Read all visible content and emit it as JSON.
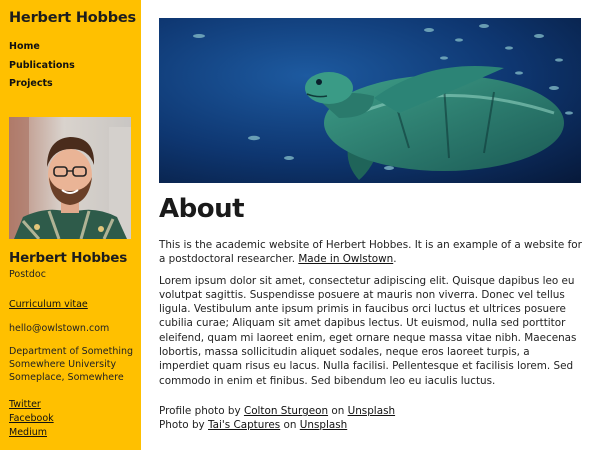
{
  "sidebar": {
    "site_title": "Herbert Hobbes",
    "nav": [
      {
        "label": "Home"
      },
      {
        "label": "Publications"
      },
      {
        "label": "Projects"
      }
    ],
    "person_name": "Herbert Hobbes",
    "person_role": "Postdoc",
    "cv_link": "Curriculum vitae",
    "email": "hello@owlstown.com",
    "address": [
      "Department of Something",
      "Somewhere University",
      "Someplace, Somewhere"
    ],
    "social": [
      {
        "label": "Twitter"
      },
      {
        "label": "Facebook"
      },
      {
        "label": "Medium"
      }
    ]
  },
  "main": {
    "hero_image": "sea-turtle-underwater-photo",
    "title": "About",
    "intro_text": "This is the academic website of Herbert Hobbes. It is an example of a website for a postdoctoral researcher. ",
    "intro_link": "Made in Owlstown",
    "intro_end": ".",
    "body_text": "Lorem ipsum dolor sit amet, consectetur adipiscing elit. Quisque dapibus leo eu volutpat sagittis. Suspendisse posuere at mauris non viverra. Donec vel tellus ligula. Vestibulum ante ipsum primis in faucibus orci luctus et ultrices posuere cubilia curae; Aliquam sit amet dapibus lectus. Ut euismod, nulla sed porttitor eleifend, quam mi laoreet enim, eget ornare neque massa vitae nibh. Maecenas lobortis, massa sollicitudin aliquet sodales, neque eros laoreet turpis, a imperdiet quam risus eu lacus. Nulla facilisi. Pellentesque et facilisis lorem. Sed commodo in enim et finibus. Sed bibendum leo eu iaculis luctus.",
    "credits": {
      "profile_prefix": "Profile photo by ",
      "profile_author": "Colton Sturgeon",
      "profile_on": " on ",
      "profile_site": "Unsplash",
      "photo_prefix": "Photo by ",
      "photo_author": "Tai's Captures",
      "photo_on": " on ",
      "photo_site": "Unsplash"
    }
  },
  "colors": {
    "sidebar_bg": "#ffc000",
    "text": "#222222",
    "ocean": "#0b2a55",
    "turtle": "#2f8a7a"
  }
}
